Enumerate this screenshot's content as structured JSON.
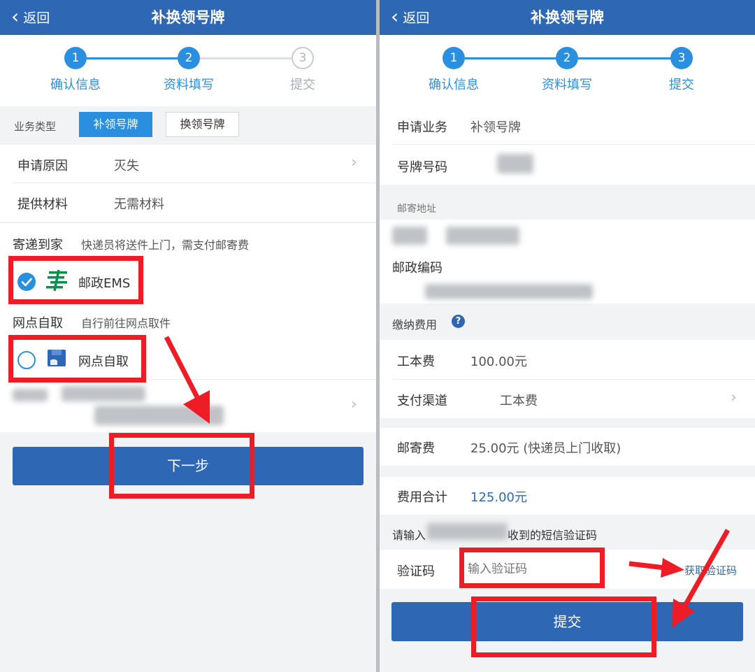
{
  "left": {
    "header": {
      "back_label": "返回",
      "title": "补换领号牌"
    },
    "steps": [
      {
        "number": "1",
        "label": "确认信息",
        "active": true
      },
      {
        "number": "2",
        "label": "资料填写",
        "active": true
      },
      {
        "number": "3",
        "label": "提交",
        "active": false
      }
    ],
    "business_type": {
      "label": "业务类型",
      "options": [
        "补领号牌",
        "换领号牌"
      ],
      "selected": "补领号牌"
    },
    "apply_reason": {
      "label": "申请原因",
      "value": "灭失"
    },
    "materials": {
      "label": "提供材料",
      "value": "无需材料"
    },
    "delivery": {
      "label": "寄递到家",
      "desc": "快递员将送件上门，需支付邮寄费",
      "option_label": "邮政EMS",
      "checked": true
    },
    "pickup": {
      "label": "网点自取",
      "desc": "自行前往网点取件",
      "option_label": "网点自取",
      "checked": false
    },
    "next_button": "下一步"
  },
  "right": {
    "header": {
      "back_label": "返回",
      "title": "补换领号牌"
    },
    "steps": [
      {
        "number": "1",
        "label": "确认信息",
        "active": true
      },
      {
        "number": "2",
        "label": "资料填写",
        "active": true
      },
      {
        "number": "3",
        "label": "提交",
        "active": true
      }
    ],
    "apply_business": {
      "label": "申请业务",
      "value": "补领号牌"
    },
    "plate_number": {
      "label": "号牌号码"
    },
    "mail_address": {
      "section_label": "邮寄地址",
      "postal_code_label": "邮政编码"
    },
    "fees": {
      "section_label": "缴纳费用",
      "help_icon": "?",
      "cost": {
        "label": "工本费",
        "value": "100.00元"
      },
      "channel": {
        "label": "支付渠道",
        "value": "工本费"
      },
      "postage": {
        "label": "邮寄费",
        "value": "25.00元 (快递员上门收取)"
      },
      "total": {
        "label": "费用合计",
        "value": "125.00元"
      }
    },
    "sms": {
      "prompt_prefix": "请输入",
      "prompt_suffix": "收到的短信验证码",
      "code_label": "验证码",
      "code_placeholder": "输入验证码",
      "get_code_label": "获取验证码"
    },
    "submit_button": "提交"
  },
  "colors": {
    "header_blue": "#2e67b4",
    "accent_blue": "#2b8fe0",
    "highlight_red": "#ee1c25",
    "ems_green": "#0a8f4e"
  }
}
